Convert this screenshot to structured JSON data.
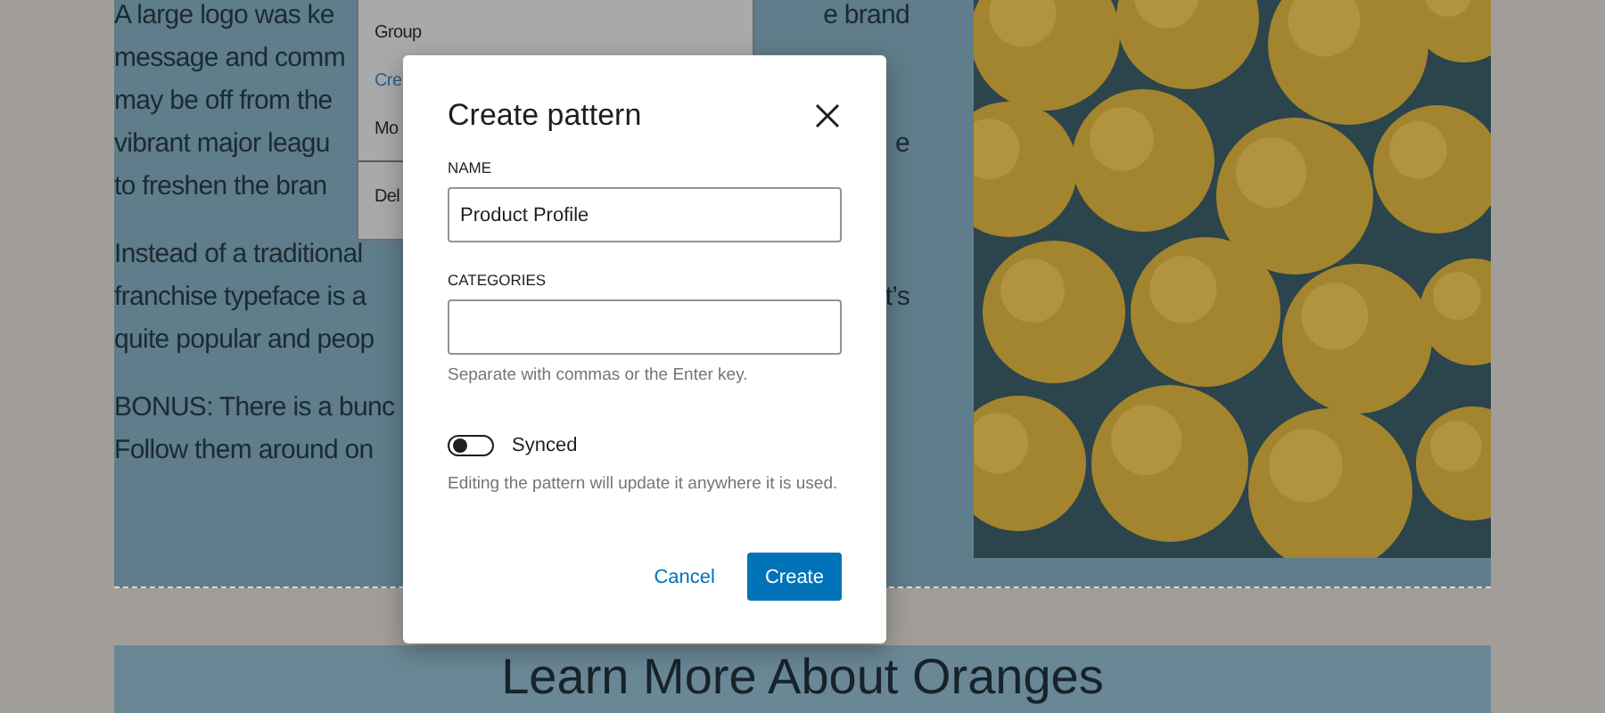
{
  "editor": {
    "paragraphs": [
      {
        "lines": [
          {
            "left": "A large logo was ke",
            "right": "e brand"
          },
          {
            "left": "message and comm"
          },
          {
            "left": "may be off from the"
          },
          {
            "left": "vibrant major leagu",
            "right": "e"
          },
          {
            "left": "to freshen the bran"
          }
        ]
      },
      {
        "lines": [
          {
            "left": "Instead of a traditional"
          },
          {
            "left": "franchise typeface is a",
            "right": "t’s"
          },
          {
            "left": "quite popular and peop"
          }
        ]
      },
      {
        "lines": [
          {
            "left": "BONUS: There is a bunc"
          },
          {
            "left": "Follow them around on"
          }
        ]
      }
    ],
    "heading": "Learn More About Oranges"
  },
  "block_menu": {
    "items": [
      {
        "label": "Group",
        "selected": false,
        "separator_before": false
      },
      {
        "label": "Cre",
        "selected": true,
        "separator_before": false
      },
      {
        "label": "Mo",
        "selected": false,
        "separator_before": false
      },
      {
        "label": "Del",
        "selected": false,
        "separator_before": true
      }
    ]
  },
  "dialog": {
    "title": "Create pattern",
    "fields": [
      {
        "label": "NAME",
        "value": "Product Profile"
      },
      {
        "label": "CATEGORIES",
        "help": "Separate with commas or the Enter key."
      }
    ],
    "toggle": {
      "label": "Synced",
      "on": false,
      "help": "Editing the pattern will update it anywhere it is used."
    },
    "buttons": [
      {
        "label": "Cancel",
        "kind": "link"
      },
      {
        "label": "Create",
        "kind": "primary"
      }
    ]
  }
}
